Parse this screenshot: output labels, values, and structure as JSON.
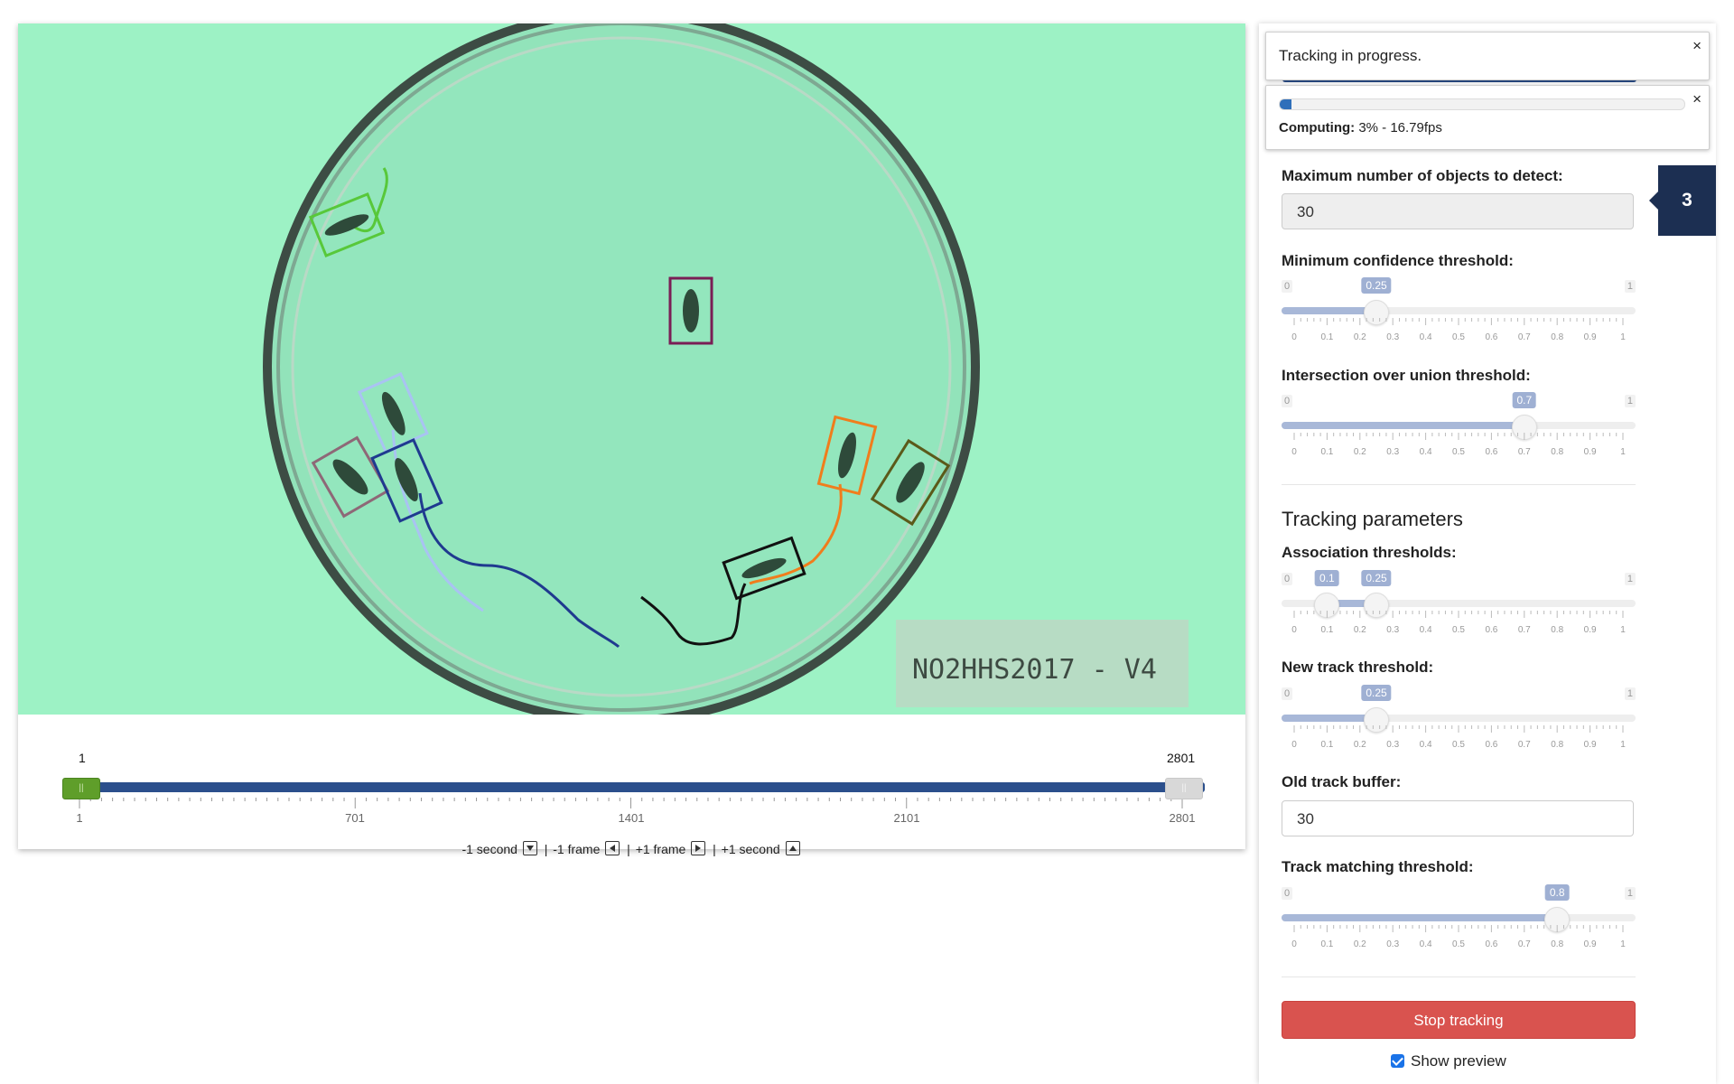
{
  "video": {
    "label_text": "NO2HHS2017 - V4",
    "box_colors": {
      "green": "#58c83a",
      "purple": "#7a1e55",
      "light_blue": "#a9c3f2",
      "mauve": "#8e6877",
      "navy": "#1f3a8f",
      "orange": "#f07d1c",
      "olive": "#5b5a1a",
      "black": "#111111"
    }
  },
  "frame_slider": {
    "min_value": "1",
    "max_value": "2801",
    "tick_labels": [
      "1",
      "701",
      "1401",
      "2101",
      "2801"
    ],
    "range_start": 1,
    "range_end": 2801
  },
  "frame_nav": {
    "minus_second": "-1 second",
    "minus_frame": "-1 frame",
    "plus_frame": "+1 frame",
    "plus_second": "+1 second",
    "separator": "|"
  },
  "notifications": {
    "tracking": {
      "message": "Tracking in progress.",
      "close": "×"
    },
    "computing": {
      "label": "Computing:",
      "detail": "3% - 16.79fps",
      "progress": 0.03,
      "close": "×"
    }
  },
  "step_badge": "3",
  "detection": {
    "max_objects_label": "Maximum number of objects to detect:",
    "max_objects_value": "30",
    "min_conf_label": "Minimum confidence threshold:",
    "min_conf": {
      "value": "0.25",
      "v": 0.25
    },
    "iou_label": "Intersection over union threshold:",
    "iou": {
      "value": "0.7",
      "v": 0.7
    }
  },
  "tracking": {
    "title": "Tracking parameters",
    "assoc_label": "Association thresholds:",
    "assoc": {
      "low": "0.1",
      "high": "0.25",
      "lo": 0.1,
      "hi": 0.25
    },
    "new_track_label": "New track threshold:",
    "new_track": {
      "value": "0.25",
      "v": 0.25
    },
    "old_buffer_label": "Old track buffer:",
    "old_buffer_value": "30",
    "match_label": "Track matching threshold:",
    "match": {
      "value": "0.8",
      "v": 0.8
    }
  },
  "slider_scale": {
    "min": "0",
    "max": "1",
    "ticks": [
      "0",
      "0.1",
      "0.2",
      "0.3",
      "0.4",
      "0.5",
      "0.6",
      "0.7",
      "0.8",
      "0.9",
      "1"
    ]
  },
  "actions": {
    "stop_label": "Stop tracking",
    "preview_label": "Show preview",
    "preview_checked": true
  },
  "colors": {
    "accent_blue": "#2b4f8c",
    "danger": "#d9534f",
    "badge": "#1c2f52",
    "video_bg": "#9df2c5"
  }
}
